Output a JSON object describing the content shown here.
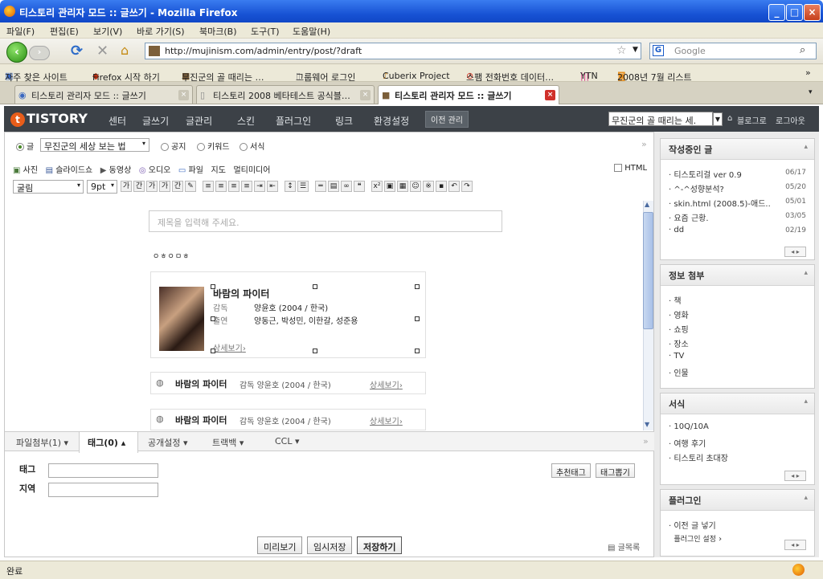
{
  "window": {
    "title": "티스토리 관리자 모드 :: 글쓰기 - Mozilla Firefox",
    "min": "_",
    "max": "□",
    "close": "×"
  },
  "menu": [
    "파일(F)",
    "편집(E)",
    "보기(V)",
    "바로 가기(S)",
    "북마크(B)",
    "도구(T)",
    "도움말(H)"
  ],
  "nav": {
    "back": "‹",
    "forward": "›",
    "url": "http://mujinism.com/admin/entry/post/?draft",
    "search_placeholder": "Google"
  },
  "bookmarks": [
    "자주 찾은 사이트",
    "Firefox 시작 하기",
    "무진군의 골 때리는 …",
    "그룹웨어 로그인",
    "Cuberix Project",
    "스팸 전화번호 데이터…",
    "YTN",
    "2008년 7월 리스트"
  ],
  "tabs": [
    {
      "label": "티스토리 관리자 모드 :: 글쓰기"
    },
    {
      "label": "티스토리 2008 베타테스트 공식블…"
    },
    {
      "label": "티스토리 관리자 모드 :: 글쓰기"
    }
  ],
  "tistory": {
    "logo": "TISTORY",
    "nav": [
      "센터",
      "글쓰기",
      "글관리",
      "스킨",
      "플러그인",
      "링크",
      "환경설정"
    ],
    "prev_mgmt": "이전 관리",
    "blog_select": "무진군의 골 때리는 세.",
    "blog_link": "블로그로",
    "logout": "로그아웃"
  },
  "editor": {
    "type_options": [
      "글",
      "공지",
      "키워드",
      "서식"
    ],
    "category": "무진군의 세상 보는 법",
    "attach": [
      "사진",
      "슬라이드쇼",
      "동영상",
      "오디오",
      "파일",
      "지도",
      "멀티미디어"
    ],
    "html_label": "HTML",
    "font": "굴림",
    "size": "9pt",
    "title_placeholder": "제목을 입력해 주세요.",
    "jamo": "ㅇㅎㅇㅁㅎ",
    "movie_card": {
      "title": "바람의 파이터",
      "director_label": "감독",
      "director": "양윤호 (2004 / 한국)",
      "cast_label": "출연",
      "cast": "양동근, 박성민, 이한갈, 성준용",
      "more": "상세보기"
    },
    "movie_rows": [
      {
        "title": "바람의 파이터",
        "meta": "감독 양윤호 (2004 / 한국)",
        "more": "상세보기"
      },
      {
        "title": "바람의 파이터",
        "meta": "감독 양윤호 (2004 / 한국)",
        "more": "상세보기"
      }
    ]
  },
  "lower_tabs": [
    "파일첨부(1)",
    "태그(0)",
    "공개설정",
    "트랙백",
    "CCL"
  ],
  "tag_section": {
    "tag_label": "태그",
    "location_label": "지역",
    "recommend": "추천태그",
    "pull": "태그뽑기"
  },
  "buttons": {
    "preview": "미리보기",
    "temp": "임시저장",
    "save": "저장하기",
    "list": "글목록"
  },
  "sidebar": {
    "drafts": {
      "title": "작성중인 글",
      "items": [
        {
          "t": "티스토리걸 ver 0.9",
          "d": "06/17"
        },
        {
          "t": "^-^성향분석?",
          "d": "05/20"
        },
        {
          "t": "skin.html (2008.5)-애드..",
          "d": "05/01"
        },
        {
          "t": "요즘 근황.",
          "d": "03/05"
        },
        {
          "t": "dd",
          "d": "02/19"
        }
      ]
    },
    "info": {
      "title": "정보 첨부",
      "items": [
        "책",
        "영화",
        "쇼핑",
        "장소",
        "TV",
        "인물"
      ]
    },
    "format": {
      "title": "서식",
      "items": [
        "10Q/10A",
        "여행 후기",
        "티스토리 초대장"
      ]
    },
    "plugin": {
      "title": "플러그인",
      "items": [
        "이전 글 넣기"
      ],
      "settings": "플러그인 설정"
    }
  },
  "status": "완료"
}
